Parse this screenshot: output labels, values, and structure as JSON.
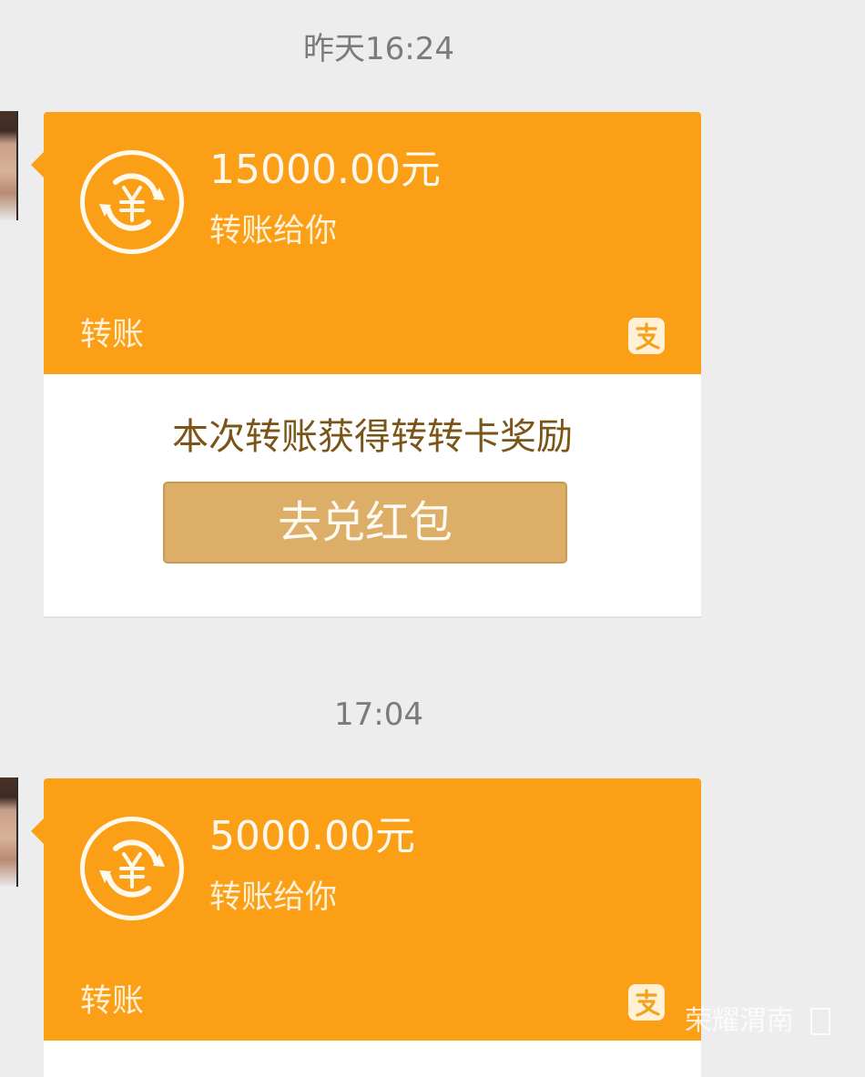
{
  "timestamps": [
    "昨天16:24",
    "17:04"
  ],
  "messages": [
    {
      "amount": "15000.00元",
      "description": "转账给你",
      "type_label": "转账",
      "reward_text": "本次转账获得转转卡奖励",
      "button_label": "去兑红包"
    },
    {
      "amount": "5000.00元",
      "description": "转账给你",
      "type_label": "转账"
    }
  ],
  "watermark": {
    "text": "荣耀渭南"
  },
  "colors": {
    "background": "#ededed",
    "card_orange": "#fb9f17",
    "button": "#dcae68",
    "reward_text": "#7a5517"
  },
  "icons": {
    "transfer": "yuan-transfer-icon",
    "payment": "alipay-badge-icon"
  }
}
